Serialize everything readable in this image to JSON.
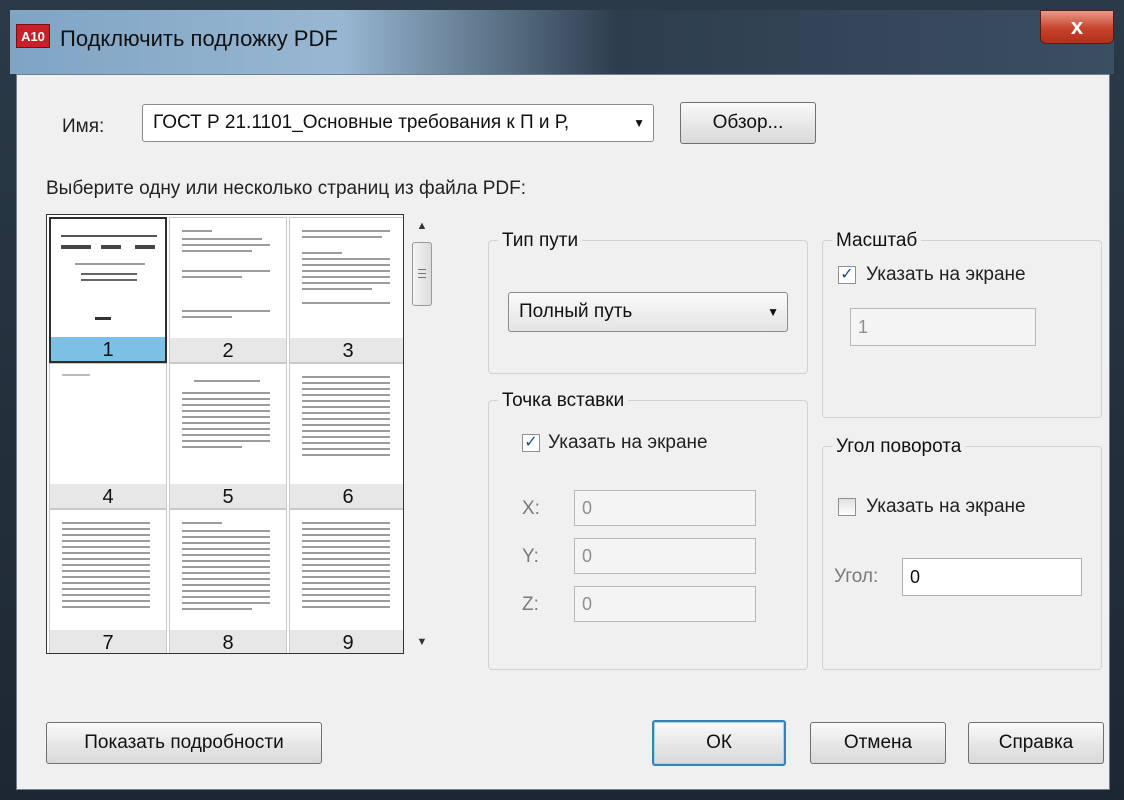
{
  "window": {
    "title": "Подключить подложку PDF",
    "app_icon": "A10",
    "close": "x"
  },
  "name": {
    "label": "Имя:",
    "value": "ГОСТ Р 21.1101_Основные требования к П и Р,",
    "browse": "Обзор..."
  },
  "pages": {
    "prompt": "Выберите одну или несколько страниц из файла PDF:",
    "items": [
      "1",
      "2",
      "3",
      "4",
      "5",
      "6",
      "7",
      "8",
      "9"
    ],
    "selected": "1"
  },
  "path_type": {
    "title": "Тип пути",
    "value": "Полный путь"
  },
  "insertion_point": {
    "title": "Точка вставки",
    "specify_on_screen": "Указать на экране",
    "checked": true,
    "x_label": "X:",
    "x_value": "0",
    "y_label": "Y:",
    "y_value": "0",
    "z_label": "Z:",
    "z_value": "0"
  },
  "scale": {
    "title": "Масштаб",
    "specify_on_screen": "Указать на экране",
    "checked": true,
    "value": "1"
  },
  "rotation": {
    "title": "Угол поворота",
    "specify_on_screen": "Указать на экране",
    "checked": false,
    "angle_label": "Угол:",
    "angle_value": "0"
  },
  "buttons": {
    "details": "Показать подробности",
    "ok": "ОК",
    "cancel": "Отмена",
    "help": "Справка"
  },
  "colors": {
    "selection": "#7cc0e6",
    "default_button_border": "#3c7fb1",
    "close_button": "#c8432c"
  }
}
